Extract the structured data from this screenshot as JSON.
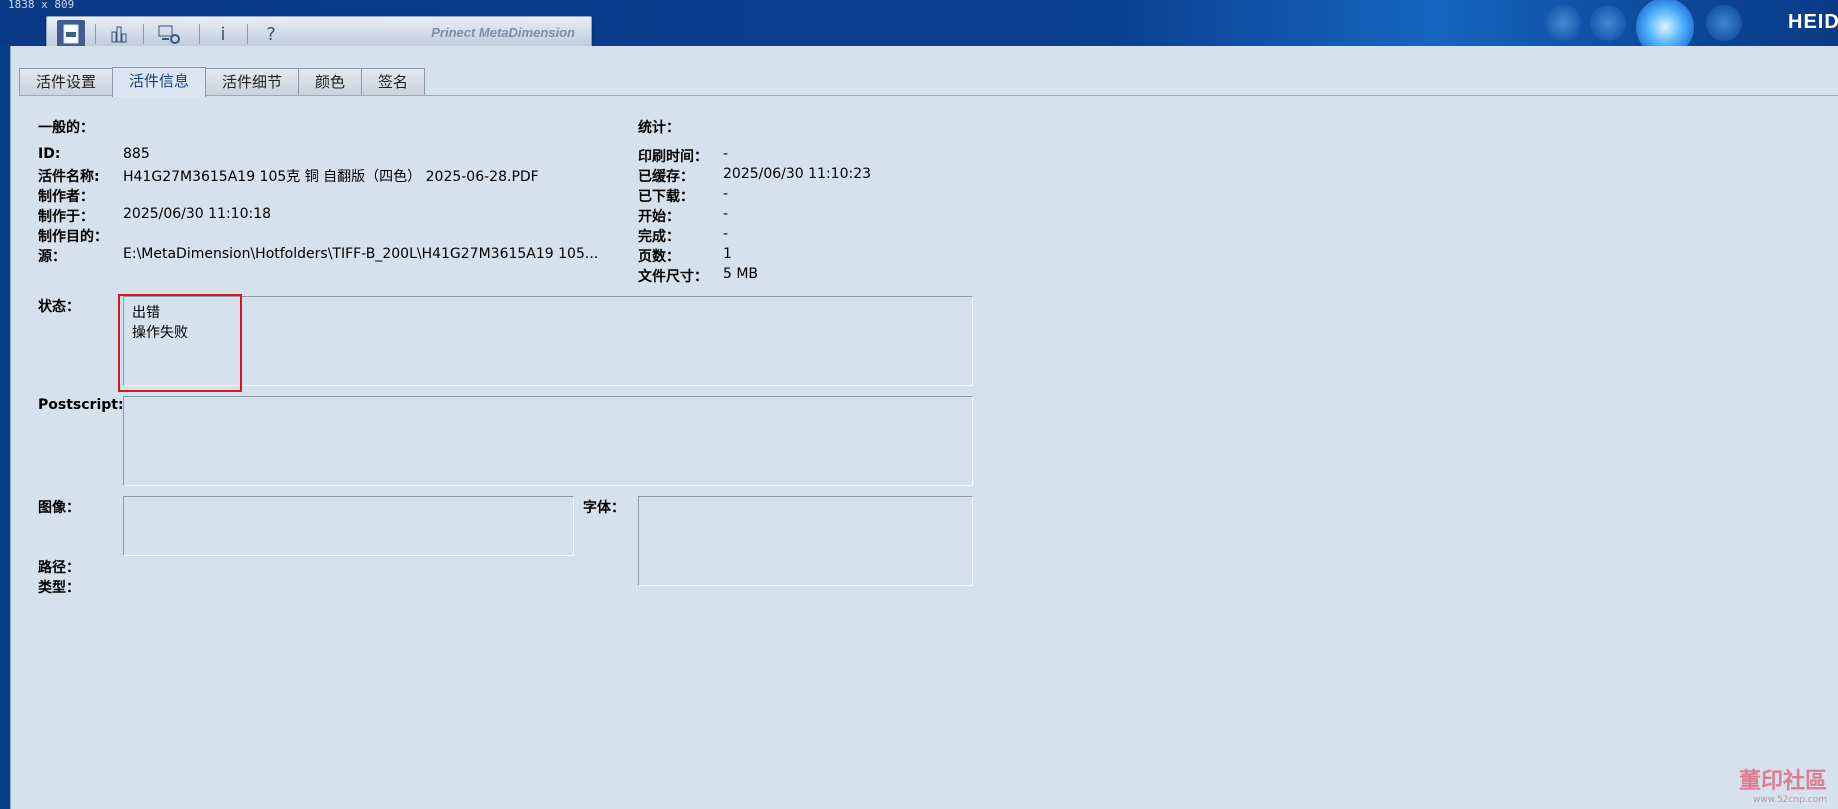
{
  "window": {
    "dimension_label": "1838 x 809",
    "brand": "HEID",
    "toolbar_title": "Prinect MetaDimension",
    "toolbar_icons": [
      "job-icon",
      "chart-icon",
      "settings-computer-icon",
      "info-icon",
      "help-icon"
    ],
    "toolbar_glyphs": {
      "info": "i",
      "help": "?"
    }
  },
  "tabs": [
    {
      "label": "活件设置",
      "active": false
    },
    {
      "label": "活件信息",
      "active": true
    },
    {
      "label": "活件细节",
      "active": false
    },
    {
      "label": "颜色",
      "active": false
    },
    {
      "label": "签名",
      "active": false
    }
  ],
  "general": {
    "heading": "一般的：",
    "id_label": "ID:",
    "id_value": "885",
    "name_label": "活件名称:",
    "name_value": "H41G27M3615A19   105克 铜 自翻版（四色） 2025-06-28.PDF",
    "creator_label": "制作者：",
    "creator_value": "",
    "created_label": "制作于：",
    "created_value": "2025/06/30 11:10:18",
    "purpose_label": "制作目的：",
    "purpose_value": "",
    "source_label": "源：",
    "source_value": "E:\\MetaDimension\\Hotfolders\\TIFF-B_200L\\H41G27M3615A19   105..."
  },
  "statistics": {
    "heading": "统计：",
    "print_time_label": "印刷时间：",
    "print_time_value": "-",
    "cached_label": "已缓存：",
    "cached_value": "2025/06/30 11:10:23",
    "downloaded_label": "已下载：",
    "downloaded_value": "-",
    "start_label": "开始：",
    "start_value": "-",
    "done_label": "完成：",
    "done_value": "-",
    "pages_label": "页数：",
    "pages_value": "1",
    "filesize_label": "文件尺寸：",
    "filesize_value": "5 MB"
  },
  "status": {
    "label": "状态：",
    "line1": "出错",
    "line2": "操作失败"
  },
  "postscript": {
    "label": "Postscript:"
  },
  "images": {
    "label": "图像："
  },
  "fonts": {
    "label": "字体："
  },
  "path": {
    "label": "路径："
  },
  "type": {
    "label": "类型："
  },
  "watermark": {
    "text": "董印社區",
    "url": "www.52cnp.com"
  },
  "colors": {
    "accent": "#0a3d8a",
    "panel": "#d6e1ee",
    "highlight": "#e0141b"
  }
}
